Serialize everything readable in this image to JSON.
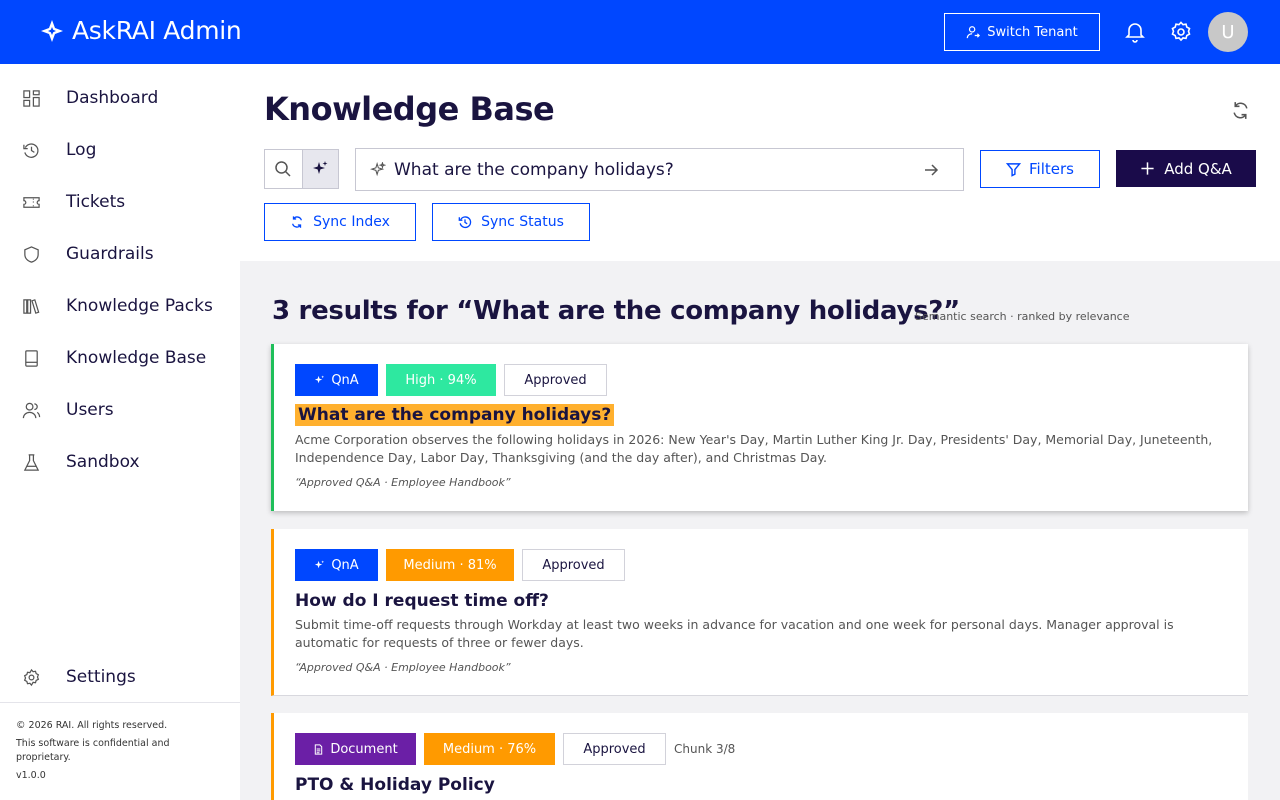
{
  "header": {
    "app_title": "AskRAI Admin",
    "switch_tenant_label": "Switch Tenant",
    "avatar_initial": "U"
  },
  "sidebar": {
    "items": [
      {
        "label": "Dashboard",
        "icon": "dashboard-icon"
      },
      {
        "label": "Log",
        "icon": "history-icon"
      },
      {
        "label": "Tickets",
        "icon": "ticket-icon"
      },
      {
        "label": "Guardrails",
        "icon": "shield-icon"
      },
      {
        "label": "Knowledge Packs",
        "icon": "books-icon"
      },
      {
        "label": "Knowledge Base",
        "icon": "book-icon"
      },
      {
        "label": "Users",
        "icon": "users-icon"
      },
      {
        "label": "Sandbox",
        "icon": "flask-icon"
      }
    ],
    "settings_label": "Settings",
    "footer": {
      "copyright": "© 2026 RAI. All rights reserved.",
      "notice": "This software is confidential and proprietary.",
      "version": "v1.0.0"
    }
  },
  "main": {
    "title": "Knowledge Base",
    "search": {
      "value": "What are the company holidays?",
      "mode": "semantic"
    },
    "filters_label": "Filters",
    "add_label": "Add Q&A",
    "sync_index_label": "Sync Index",
    "sync_status_label": "Sync Status",
    "results_heading": "3 results for “What are the company holidays?”",
    "results_sub": "Semantic search · ranked by relevance",
    "results": [
      {
        "type": "QnA",
        "relevance": "High · 94%",
        "status": "Approved",
        "title": "What are the company holidays?",
        "body": "Acme Corporation observes the following holidays in 2026: New Year's Day, Martin Luther King Jr. Day, Presidents' Day, Memorial Day, Juneteenth, Independence Day, Labor Day, Thanksgiving (and the day after), and Christmas Day.",
        "source": "“Approved Q&A · Employee Handbook”"
      },
      {
        "type": "QnA",
        "relevance": "Medium · 81%",
        "status": "Approved",
        "title": "How do I request time off?",
        "body": "Submit time-off requests through Workday at least two weeks in advance for vacation and one week for personal days. Manager approval is automatic for requests of three or fewer days.",
        "source": "“Approved Q&A · Employee Handbook”"
      },
      {
        "type": "Document",
        "relevance": "Medium · 76%",
        "status": "Approved",
        "chunk": "Chunk 3/8",
        "title": "PTO & Holiday Policy"
      }
    ]
  },
  "colors": {
    "brand_blue": "#0047ff",
    "navy": "#1a0b4a",
    "high_green": "#2ee8a0",
    "medium_orange": "#ff9a00",
    "document_purple": "#6b1fa6",
    "highlight": "#ffb02e"
  }
}
